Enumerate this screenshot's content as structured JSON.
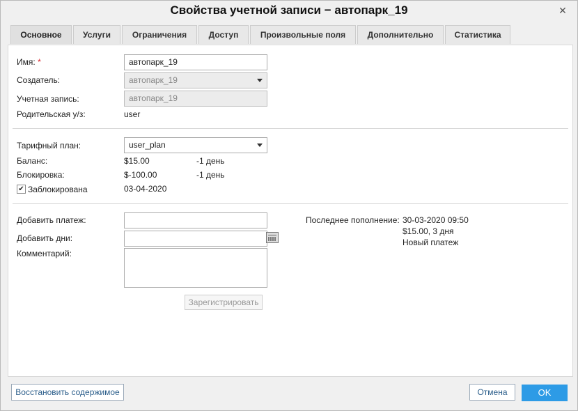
{
  "window": {
    "title": "Свойства учетной записи − автопарк_19"
  },
  "tabs": [
    {
      "label": "Основное"
    },
    {
      "label": "Услуги"
    },
    {
      "label": "Ограничения"
    },
    {
      "label": "Доступ"
    },
    {
      "label": "Произвольные поля"
    },
    {
      "label": "Дополнительно"
    },
    {
      "label": "Статистика"
    }
  ],
  "fields": {
    "name_label": "Имя:",
    "name_required": "*",
    "name_value": "автопарк_19",
    "creator_label": "Создатель:",
    "creator_value": "автопарк_19",
    "account_label": "Учетная запись:",
    "account_value": "автопарк_19",
    "parent_label": "Родительская у/з:",
    "parent_value": "user"
  },
  "tariff": {
    "plan_label": "Тарифный план:",
    "plan_value": "user_plan",
    "balance_label": "Баланс:",
    "balance_value": "$15.00",
    "balance_days": "-1 день",
    "block_label": "Блокировка:",
    "block_value": "$-100.00",
    "block_days": "-1 день",
    "blocked_label": "Заблокирована",
    "blocked_checked": true,
    "blocked_date": "03-04-2020"
  },
  "payment": {
    "add_payment_label": "Добавить платеж:",
    "add_payment_value": "",
    "add_days_label": "Добавить дни:",
    "add_days_value": "",
    "comment_label": "Комментарий:",
    "comment_value": "",
    "register_label": "Зарегистрировать",
    "last_topup_label": "Последнее пополнение:",
    "last_topup_date": "30-03-2020 09:50",
    "last_topup_amount": "$15.00, 3 дня",
    "last_topup_note": "Новый платеж"
  },
  "footer": {
    "restore_label": "Восстановить содержимое",
    "cancel_label": "Отмена",
    "ok_label": "OK"
  }
}
